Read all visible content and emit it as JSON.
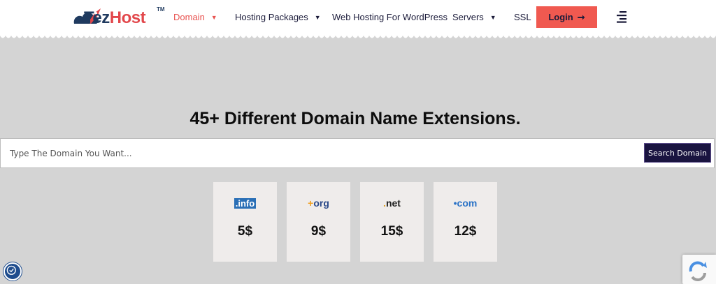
{
  "brand": {
    "name_part1": "Tez",
    "name_part2": "Host",
    "tm": "TM"
  },
  "nav": {
    "domain": "Domain",
    "hosting_packages": "Hosting Packages",
    "wordpress": "Web Hosting For WordPress",
    "servers": "Servers",
    "ssl": "SSL",
    "login": "Login",
    "login_arrow": "➞"
  },
  "hero": {
    "headline": "45+ Different Domain Name Extensions."
  },
  "search": {
    "placeholder": "Type The Domain You Want...",
    "button_label": "Search Domain"
  },
  "extensions": [
    {
      "ext": ".info",
      "price": "5$"
    },
    {
      "ext": "org",
      "price": "9$"
    },
    {
      "ext": "net",
      "price": "15$"
    },
    {
      "ext": "com",
      "price": "12$"
    }
  ],
  "colors": {
    "accent": "#e8524f",
    "login_bg": "#f05950",
    "search_btn_bg": "#1a1440",
    "navy": "#1b1b3a"
  },
  "icons": {
    "caret": "caret-down-icon",
    "menu": "menu-lines-icon",
    "accessibility": "accessibility-icon",
    "recaptcha": "recaptcha-icon"
  }
}
